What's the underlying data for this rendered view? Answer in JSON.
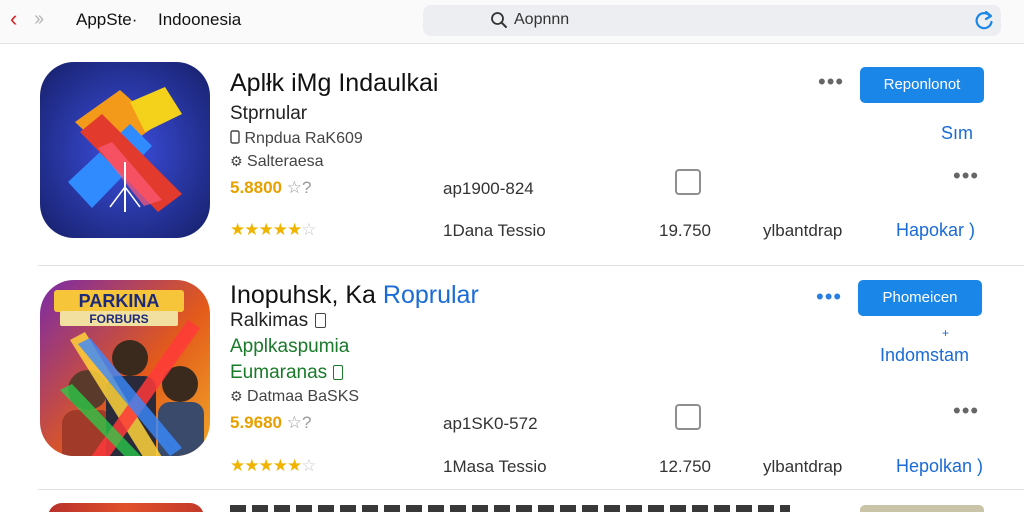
{
  "topbar": {
    "back_glyph": "‹",
    "forward_glyph": "››",
    "app_title": "AppSte·",
    "region": "Indoonesia",
    "search_text": "Aopnnn"
  },
  "apps": [
    {
      "name": "Aplłk iMg Indaulkai",
      "name_accent": "",
      "line2": "Stprnular",
      "line3": "Rnpdua RaK609",
      "line4": "Salteraesa",
      "rating": "5.8800",
      "rating_suffix": "☆?",
      "stars": "★★★★★",
      "stars_off": "☆",
      "code": "ap1900-824",
      "downloads": "1Dana Tessio",
      "size": "19.750",
      "category": "ylbantdrap",
      "button": "Reponlonot",
      "link_small": "Sım",
      "link": "Hapokar )"
    },
    {
      "name": "Inopuhsk, Ka ",
      "name_accent": "Roprular",
      "line2": "Ralkimas",
      "line3": "Applkaspumia",
      "line4": "Eumaranas",
      "line5": "Datmaa BaSKS",
      "rating": "5.9680",
      "rating_suffix": "☆?",
      "stars": "★★★★★",
      "stars_off": "☆",
      "code": "ap1SK0-572",
      "downloads": "1Masa Tessio",
      "size": "12.750",
      "category": "ylbantdrap",
      "button": "Phomeicen",
      "link_small": "Indomstam",
      "link": "Hepolkan )",
      "banner": "PARKINA",
      "banner_sub": "FORBURS"
    }
  ],
  "colors": {
    "accent_blue": "#1a86e8",
    "link_blue": "#1a6bd6",
    "star_gold": "#f0b400",
    "rating_orange": "#e8a000",
    "back_red": "#d32020"
  },
  "icons": [
    "chevron-left-icon",
    "chevron-right-icon",
    "search-icon",
    "refresh-icon",
    "more-icon",
    "checkbox-icon",
    "phone-icon",
    "gear-icon"
  ]
}
